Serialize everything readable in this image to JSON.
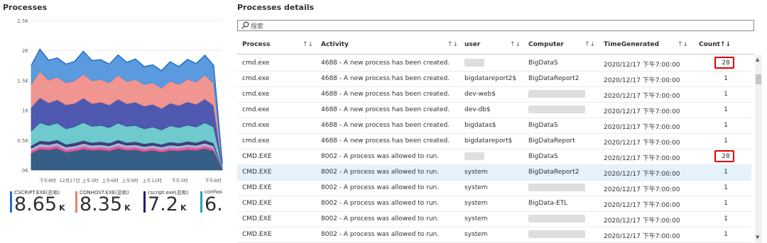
{
  "left_panel": {
    "title": "Processes"
  },
  "chart_data": {
    "type": "area",
    "stacked": true,
    "y_ticks": [
      "2.5K",
      "2K",
      "1.5K",
      "1K",
      "0.5K",
      "0K"
    ],
    "ylim": [
      0,
      2500
    ],
    "x_tick_labels": [
      "下午8时",
      "12月17日",
      "上午3时",
      "上午6时",
      "上午9时",
      "上午12时",
      "下午3时",
      "下午6时"
    ],
    "colors": [
      "#1f4e79",
      "#e8468c",
      "#a0a8d0",
      "#2b2b6b",
      "#5ec4c8",
      "#3b47a6",
      "#f08a84",
      "#4a8fdc"
    ],
    "series": [
      {
        "values": [
          280,
          350,
          340,
          360,
          300,
          320,
          350,
          330,
          340,
          320,
          360,
          330,
          340,
          310,
          330,
          300,
          330,
          320,
          340,
          330,
          360,
          320,
          30
        ]
      },
      {
        "values": [
          40,
          40,
          40,
          45,
          40,
          40,
          45,
          40,
          40,
          40,
          45,
          40,
          40,
          40,
          40,
          40,
          40,
          40,
          45,
          40,
          40,
          40,
          5
        ]
      },
      {
        "values": [
          45,
          50,
          45,
          50,
          45,
          45,
          50,
          45,
          45,
          45,
          50,
          45,
          45,
          45,
          45,
          45,
          50,
          45,
          45,
          45,
          50,
          45,
          5
        ]
      },
      {
        "values": [
          45,
          50,
          50,
          50,
          45,
          50,
          50,
          45,
          50,
          45,
          50,
          45,
          50,
          45,
          45,
          45,
          50,
          45,
          50,
          45,
          50,
          45,
          5
        ]
      },
      {
        "values": [
          240,
          300,
          270,
          280,
          260,
          270,
          300,
          270,
          270,
          260,
          280,
          270,
          270,
          250,
          260,
          240,
          270,
          260,
          270,
          260,
          290,
          270,
          20
        ]
      },
      {
        "values": [
          400,
          420,
          380,
          390,
          400,
          390,
          410,
          380,
          390,
          380,
          400,
          380,
          390,
          380,
          380,
          360,
          380,
          370,
          390,
          380,
          400,
          360,
          20
        ]
      },
      {
        "values": [
          380,
          440,
          380,
          380,
          370,
          380,
          400,
          380,
          380,
          370,
          400,
          370,
          380,
          360,
          360,
          340,
          370,
          350,
          380,
          370,
          400,
          370,
          15
        ]
      },
      {
        "values": [
          320,
          370,
          330,
          320,
          310,
          320,
          380,
          340,
          330,
          310,
          340,
          320,
          340,
          300,
          300,
          290,
          320,
          300,
          330,
          310,
          330,
          300,
          10
        ]
      }
    ]
  },
  "tiles": [
    {
      "label": "CSCRIPT.EXE(总和)",
      "value": "8.65",
      "unit": "K",
      "color": "#1e6fc8"
    },
    {
      "label": "CONHOST.EXE(总和)",
      "value": "8.35",
      "unit": "K",
      "color": "#f07a6e"
    },
    {
      "label": "cscript.exe(总和)",
      "value": "7.2",
      "unit": "K",
      "color": "#1b1f73"
    },
    {
      "label": "conhos",
      "value": "6.",
      "unit": "",
      "color": "#20a8b0"
    }
  ],
  "right_panel": {
    "title": "Processes details"
  },
  "search": {
    "placeholder": "搜索"
  },
  "table": {
    "columns": [
      {
        "label": "Process",
        "sort": "↑↓"
      },
      {
        "label": "Activity",
        "sort": "↑↓"
      },
      {
        "label": "user",
        "sort": "↑↓"
      },
      {
        "label": "Computer",
        "sort": "↑↓"
      },
      {
        "label": "TimeGenerated",
        "sort": "↑↓"
      },
      {
        "label": "Count↑↓",
        "sort": ""
      }
    ],
    "rows": [
      {
        "process": "cmd.exe",
        "activity": "4688 - A new process has been created.",
        "user": "",
        "computer": "BigDataS",
        "time": "2020/12/17 下午7:00:00",
        "count": "28"
      },
      {
        "process": "cmd.exe",
        "activity": "4688 - A new process has been created.",
        "user": "bigdatareport2$",
        "computer": "BigDataReport2",
        "time": "2020/12/17 下午7:00:00",
        "count": "1"
      },
      {
        "process": "cmd.exe",
        "activity": "4688 - A new process has been created.",
        "user": "dev-web$",
        "computer": "",
        "time": "2020/12/17 下午7:00:00",
        "count": "1"
      },
      {
        "process": "cmd.exe",
        "activity": "4688 - A new process has been created.",
        "user": "dev-db$",
        "computer": "",
        "time": "2020/12/17 下午7:00:00",
        "count": "1"
      },
      {
        "process": "cmd.exe",
        "activity": "4688 - A new process has been created.",
        "user": "bigdatas$",
        "computer": "BigDataS",
        "time": "2020/12/17 下午7:00:00",
        "count": "1"
      },
      {
        "process": "cmd.exe",
        "activity": "4688 - A new process has been created.",
        "user": "bigdatareport$",
        "computer": "BigDataReport",
        "time": "2020/12/17 下午7:00:00",
        "count": "1"
      },
      {
        "process": "CMD.EXE",
        "activity": "8002 - A process was allowed to run.",
        "user": "",
        "computer": "BigDataS",
        "time": "2020/12/17 下午7:00:00",
        "count": "28"
      },
      {
        "process": "CMD.EXE",
        "activity": "8002 - A process was allowed to run.",
        "user": "system",
        "computer": "BigDataReport2",
        "time": "2020/12/17 下午7:00:00",
        "count": "1"
      },
      {
        "process": "CMD.EXE",
        "activity": "8002 - A process was allowed to run.",
        "user": "system",
        "computer": "",
        "time": "2020/12/17 下午7:00:00",
        "count": "1"
      },
      {
        "process": "CMD.EXE",
        "activity": "8002 - A process was allowed to run.",
        "user": "system",
        "computer": "BigData-ETL",
        "time": "2020/12/17 下午7:00:00",
        "count": "1"
      },
      {
        "process": "CMD.EXE",
        "activity": "8002 - A process was allowed to run.",
        "user": "system",
        "computer": "",
        "time": "2020/12/17 下午7:00:00",
        "count": "1"
      },
      {
        "process": "CMD.EXE",
        "activity": "8002 - A process was allowed to run.",
        "user": "system",
        "computer": "",
        "time": "2020/12/17 下午7:00:00",
        "count": "1"
      }
    ]
  }
}
